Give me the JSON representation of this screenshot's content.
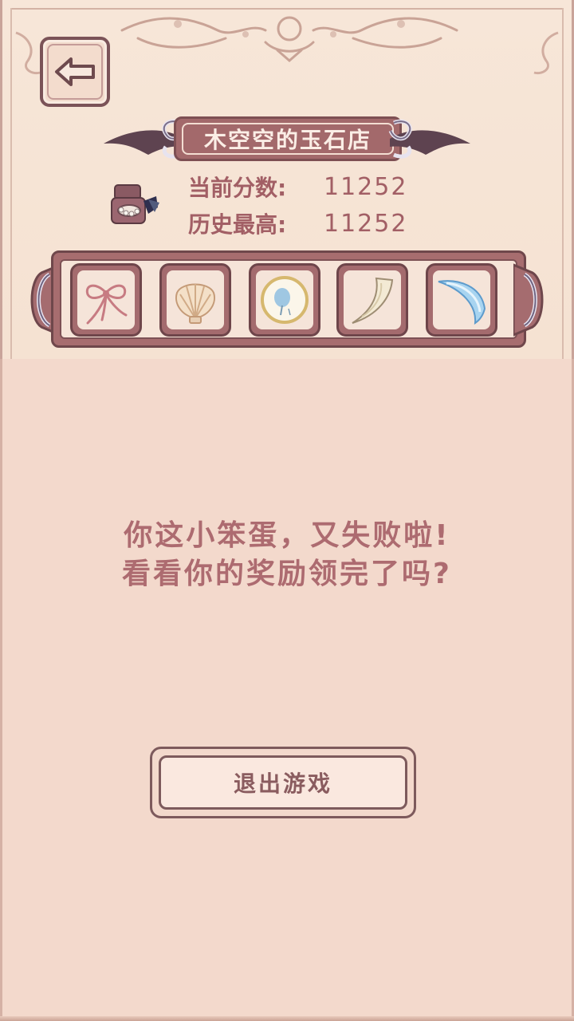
{
  "header": {
    "title": "木空空的玉石店",
    "back_icon": "arrow-left-icon"
  },
  "scores": {
    "current_label": "当前分数:",
    "current_value": "11252",
    "best_label": "历史最高:",
    "best_value": "11252",
    "icon": "jewelry-box-icon"
  },
  "items": [
    {
      "name": "ribbon-bow-icon"
    },
    {
      "name": "seashell-icon"
    },
    {
      "name": "blue-stone-plate-icon"
    },
    {
      "name": "ivory-tusk-icon"
    },
    {
      "name": "blue-crescent-icon"
    }
  ],
  "message": {
    "line1": "你这小笨蛋，又失败啦!",
    "line2": "看看你的奖励领完了吗?"
  },
  "exit_button": {
    "label": "退出游戏"
  },
  "colors": {
    "background": "#f3d9cc",
    "parchment": "#f6e4d8",
    "frame": "#a76d6f",
    "frame_dark": "#6f474b",
    "text": "#ad6b70"
  }
}
